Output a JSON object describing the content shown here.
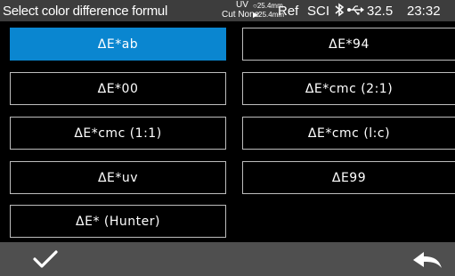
{
  "status_bar": {
    "title": "Select color difference formul",
    "light_source": "UV",
    "uv_cut": "Cut None",
    "aperture_top": "25.4mm",
    "aperture_bottom": "25.4mm",
    "mode_ref": "Ref",
    "mode_sci": "SCI",
    "bluetooth_icon": "bluetooth-icon",
    "usb_icon": "usb-icon",
    "temperature": "32.5",
    "time": "23:32"
  },
  "formulas": [
    {
      "label": "ΔE*ab",
      "selected": true
    },
    {
      "label": "ΔE*94",
      "selected": false
    },
    {
      "label": "ΔE*00",
      "selected": false
    },
    {
      "label": "ΔE*cmc (2:1)",
      "selected": false
    },
    {
      "label": "ΔE*cmc (1:1)",
      "selected": false
    },
    {
      "label": "ΔE*cmc (l:c)",
      "selected": false
    },
    {
      "label": "ΔE*uv",
      "selected": false
    },
    {
      "label": "ΔE99",
      "selected": false
    },
    {
      "label": "ΔE* (Hunter)",
      "selected": false
    }
  ],
  "bottom_bar": {
    "confirm_icon": "checkmark-icon",
    "back_icon": "return-arrow-icon"
  },
  "colors": {
    "selected": "#0a86d0",
    "status_bar": "#3d3d3d",
    "bottom_bar": "#4f4f4f",
    "border": "#bdbdbd"
  }
}
